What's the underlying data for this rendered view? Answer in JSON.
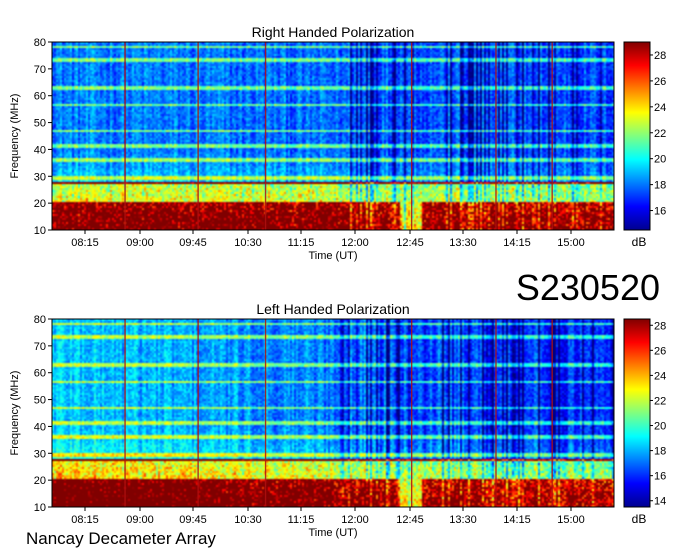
{
  "observatory": "Nancay Decameter Array",
  "date_code": "S230520",
  "chart_data": [
    {
      "type": "heatmap",
      "title": "Right Handed Polarization",
      "xlabel": "Time (UT)",
      "ylabel": "Frequency (MHz)",
      "x_ticks": [
        "08:15",
        "09:00",
        "09:45",
        "10:30",
        "11:15",
        "12:00",
        "12:45",
        "13:30",
        "14:15",
        "15:00"
      ],
      "y_ticks": [
        10,
        20,
        30,
        40,
        50,
        60,
        70,
        80
      ],
      "ylim": [
        10,
        80
      ],
      "colorbar": {
        "label": "dB",
        "ticks": [
          16,
          18,
          20,
          22,
          24,
          26,
          28
        ],
        "range": [
          14.5,
          29
        ]
      }
    },
    {
      "type": "heatmap",
      "title": "Left Handed Polarization",
      "xlabel": "Time (UT)",
      "ylabel": "Frequency (MHz)",
      "x_ticks": [
        "08:15",
        "09:00",
        "09:45",
        "10:30",
        "11:15",
        "12:00",
        "12:45",
        "13:30",
        "14:15",
        "15:00"
      ],
      "y_ticks": [
        10,
        20,
        30,
        40,
        50,
        60,
        70,
        80
      ],
      "ylim": [
        10,
        80
      ],
      "colorbar": {
        "label": "dB",
        "ticks": [
          14,
          16,
          18,
          20,
          22,
          24,
          26,
          28
        ],
        "range": [
          13.5,
          28.5
        ]
      }
    }
  ]
}
